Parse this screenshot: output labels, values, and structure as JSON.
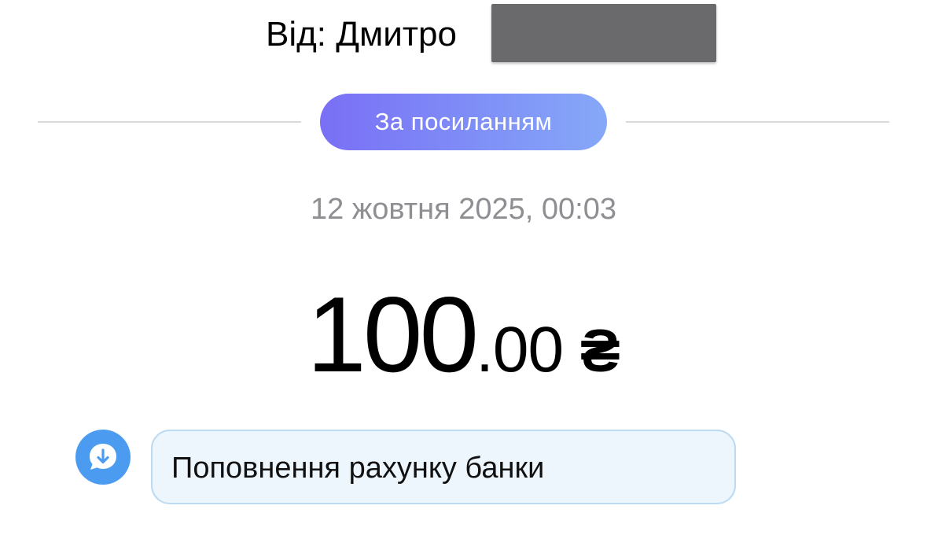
{
  "sender": {
    "label": "Від: Дмитро"
  },
  "transfer": {
    "type_label": "За посиланням",
    "datetime": "12 жовтня 2025, 00:03"
  },
  "amount": {
    "integer_part": "100",
    "decimal_part": ".00",
    "currency_symbol": "₴"
  },
  "comment": {
    "icon": "download-comment-icon",
    "text": "Поповнення рахунку банки"
  },
  "colors": {
    "pill_gradient_start": "#7a6ff5",
    "pill_gradient_end": "#86a8f8",
    "date_gray": "#8e8e93",
    "icon_blue": "#4b9cf1",
    "bubble_bg": "#eef6fd",
    "bubble_border": "#bcdaf1"
  }
}
